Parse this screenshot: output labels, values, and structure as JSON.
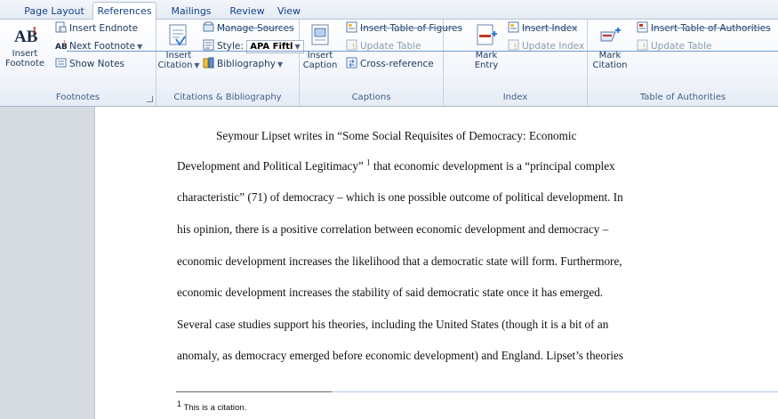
{
  "tabs": [
    {
      "label": "Page Layout",
      "active": false
    },
    {
      "label": "References",
      "active": true
    },
    {
      "label": "Mailings",
      "active": false
    },
    {
      "label": "Review",
      "active": false
    },
    {
      "label": "View",
      "active": false
    }
  ],
  "footnotes_group": {
    "label": "Footnotes",
    "insert_footnote_line1": "Insert",
    "insert_footnote_line2": "Footnote",
    "insert_endnote": "Insert Endnote",
    "next_footnote": "Next Footnote",
    "show_notes": "Show Notes"
  },
  "citations_group": {
    "label": "Citations & Bibliography",
    "insert_citation_line1": "Insert",
    "insert_citation_line2": "Citation",
    "manage_sources": "Manage Sources",
    "style_label": "Style:",
    "style_value": "APA Fiftl",
    "bibliography": "Bibliography"
  },
  "captions_group": {
    "label": "Captions",
    "insert_caption_line1": "Insert",
    "insert_caption_line2": "Caption",
    "insert_table_of_figures": "Insert Table of Figures",
    "update_table": "Update Table",
    "cross_reference": "Cross-reference"
  },
  "index_group": {
    "label": "Index",
    "mark_entry_line1": "Mark",
    "mark_entry_line2": "Entry",
    "insert_index": "Insert Index",
    "update_index": "Update Index"
  },
  "authorities_group": {
    "label": "Table of Authorities",
    "mark_citation_line1": "Mark",
    "mark_citation_line2": "Citation",
    "insert_table_of_authorities": "Insert Table of Authorities",
    "update_table": "Update Table"
  },
  "document": {
    "line1": "Seymour Lipset writes in “Some Social Requisites of Democracy: Economic",
    "line2_a": "Development and Political Legitimacy” ",
    "line2_ref": "1",
    "line2_b": " that economic development is a “principal complex",
    "line3": "characteristic” (71) of democracy – which is one possible outcome of political development. In",
    "line4": "his opinion, there is a positive correlation between economic development and democracy –",
    "line5": "economic development increases the likelihood that a democratic state will form. Furthermore,",
    "line6": "economic development increases the stability of said democratic state once it has emerged.",
    "line7": "Several case studies support his theories, including the United States (though it is a bit of an",
    "line8": "anomaly, as democracy emerged before economic development) and England. Lipset’s theories"
  },
  "footnote": {
    "number": "1",
    "text": " This is a citation."
  }
}
